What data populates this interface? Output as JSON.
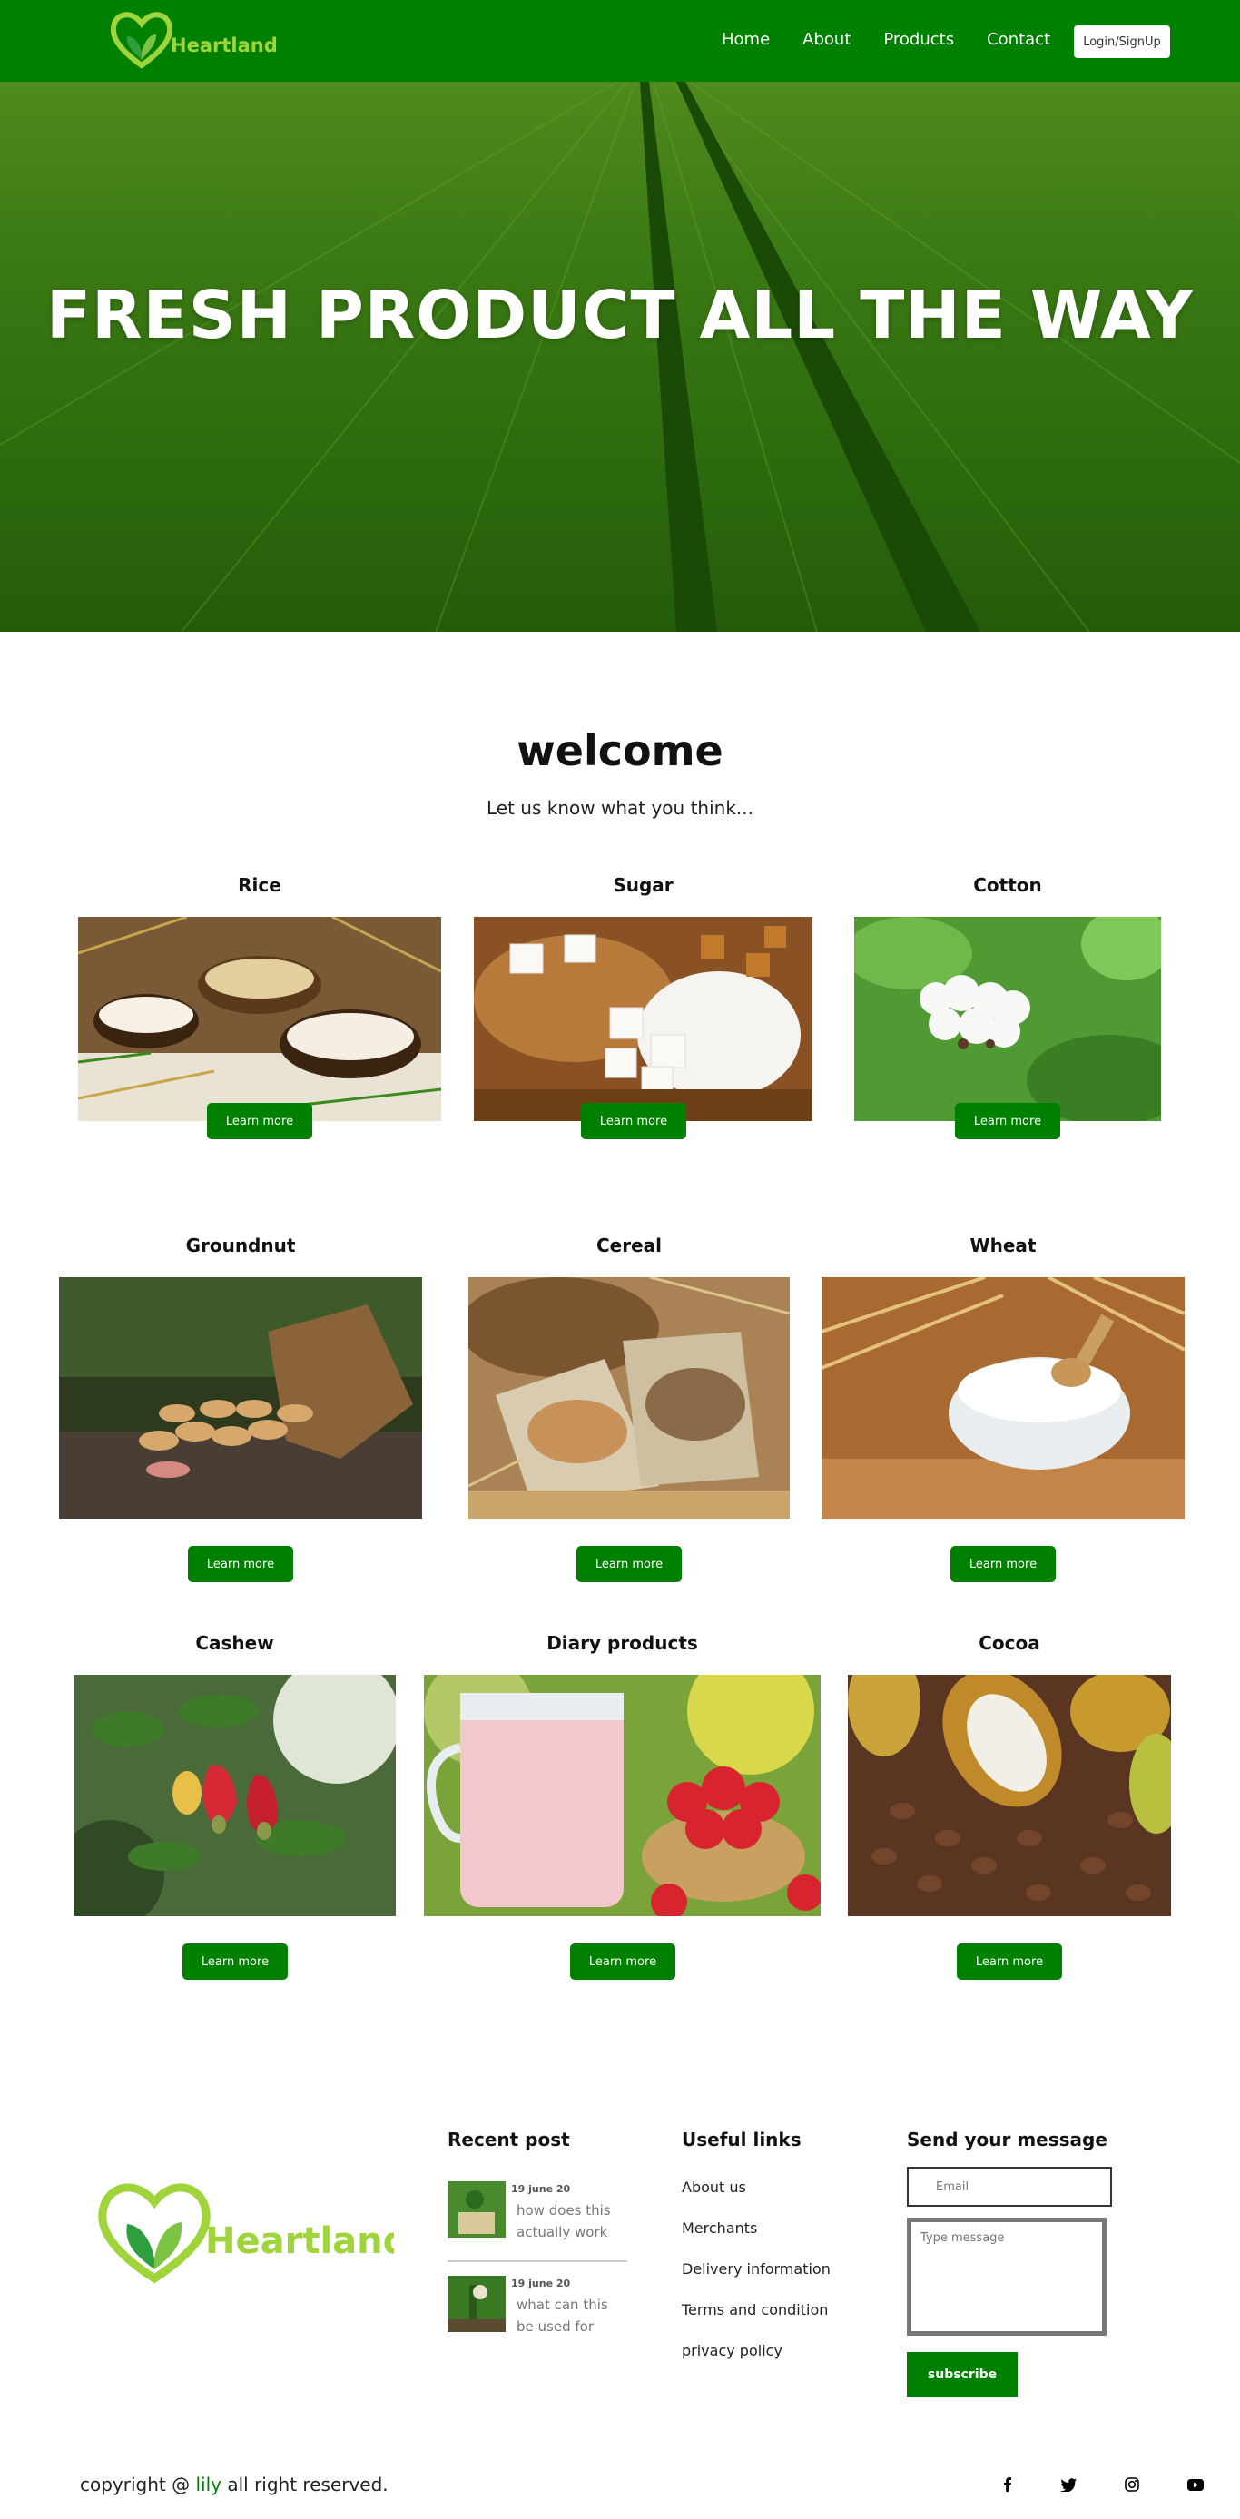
{
  "nav": {
    "logo_text": "Heartland",
    "links": [
      "Home",
      "About",
      "Products",
      "Contact"
    ],
    "login_label": "Login/SignUp"
  },
  "hero": {
    "title": "FRESH PRODUCT ALL THE WAY"
  },
  "welcome": {
    "title": "welcome",
    "subtitle": "Let us know what you think..."
  },
  "products": [
    {
      "name": "Rice",
      "button": "Learn more",
      "image": "rice-bowls"
    },
    {
      "name": "Sugar",
      "button": "Learn more",
      "image": "sugar-cubes"
    },
    {
      "name": "Cotton",
      "button": "Learn more",
      "image": "cotton-bolls"
    },
    {
      "name": "Groundnut",
      "button": "Learn more",
      "image": "groundnut-sack"
    },
    {
      "name": "Cereal",
      "button": "Learn more",
      "image": "cereal-sacks"
    },
    {
      "name": "Wheat",
      "button": "Learn more",
      "image": "wheat-flour-bowl"
    },
    {
      "name": "Cashew",
      "button": "Learn more",
      "image": "cashew-fruits"
    },
    {
      "name": "Diary products",
      "button": "Learn more",
      "image": "strawberry-milkshake"
    },
    {
      "name": "Cocoa",
      "button": "Learn more",
      "image": "cocoa-beans"
    }
  ],
  "footer": {
    "logo_text": "Heartland",
    "recent_post_title": "Recent post",
    "posts": [
      {
        "date": "19 june 20",
        "text": "how does this actually work"
      },
      {
        "date": "19 june 20",
        "text": "what can this be used for"
      }
    ],
    "useful_links_title": "Useful links",
    "useful_links": [
      "About us",
      "Merchants",
      "Delivery information",
      "Terms and condition",
      "privacy policy"
    ],
    "message_title": "Send your message",
    "email_placeholder": "Email",
    "message_placeholder": "Type message",
    "subscribe_label": "subscribe",
    "copyright_prefix": "copyright @ ",
    "copyright_brand": "lily",
    "copyright_suffix": " all right reserved.",
    "social_icons": [
      "facebook-icon",
      "twitter-icon",
      "instagram-icon",
      "youtube-icon"
    ]
  },
  "colors": {
    "primary_green": "#008000",
    "logo_green": "#9fd43a",
    "white": "#ffffff"
  }
}
